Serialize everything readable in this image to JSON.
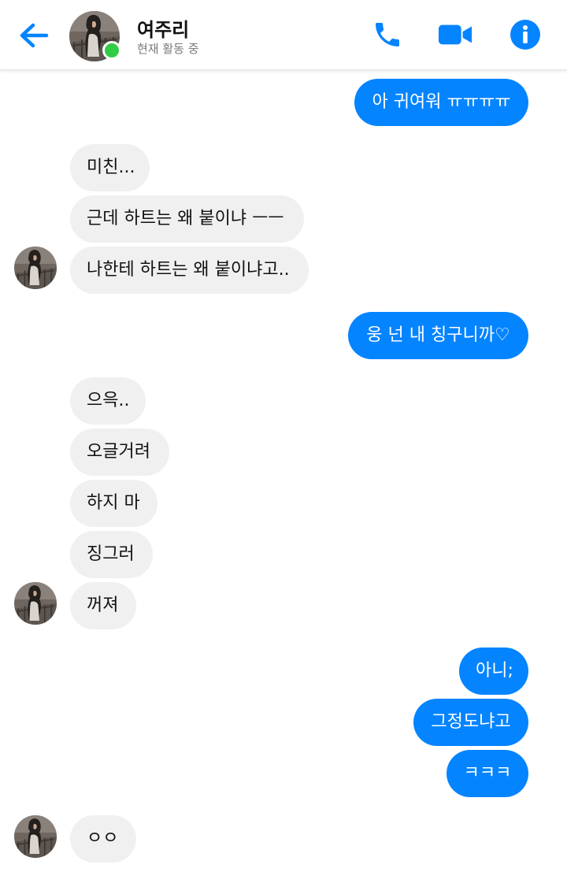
{
  "header": {
    "contact_name": "여주리",
    "status": "현재 활동 중"
  },
  "colors": {
    "accent": "#0584ff",
    "incoming_bubble": "#f0f0f0",
    "online": "#31cc46"
  },
  "icons": {
    "back": "arrow-left-icon",
    "call": "phone-icon",
    "video": "video-camera-icon",
    "info": "info-icon"
  },
  "messages": [
    {
      "side": "out",
      "text": "아 귀여워 ㅠㅠㅠㅠ"
    },
    {
      "side": "in",
      "text": "미친..."
    },
    {
      "side": "in",
      "text": "근데 하트는 왜 붙이냐 ㅡㅡ"
    },
    {
      "side": "in",
      "text": "나한테 하트는 왜 붙이냐고.."
    },
    {
      "side": "out",
      "text": "웅 넌 내 칭구니까♡"
    },
    {
      "side": "in",
      "text": "으윽.."
    },
    {
      "side": "in",
      "text": "오글거려"
    },
    {
      "side": "in",
      "text": "하지 마"
    },
    {
      "side": "in",
      "text": "징그러"
    },
    {
      "side": "in",
      "text": "꺼져"
    },
    {
      "side": "out",
      "text": "아니;"
    },
    {
      "side": "out",
      "text": "그정도냐고"
    },
    {
      "side": "out",
      "text": "ㅋㅋㅋ"
    },
    {
      "side": "in",
      "text": "ㅇㅇ"
    }
  ]
}
